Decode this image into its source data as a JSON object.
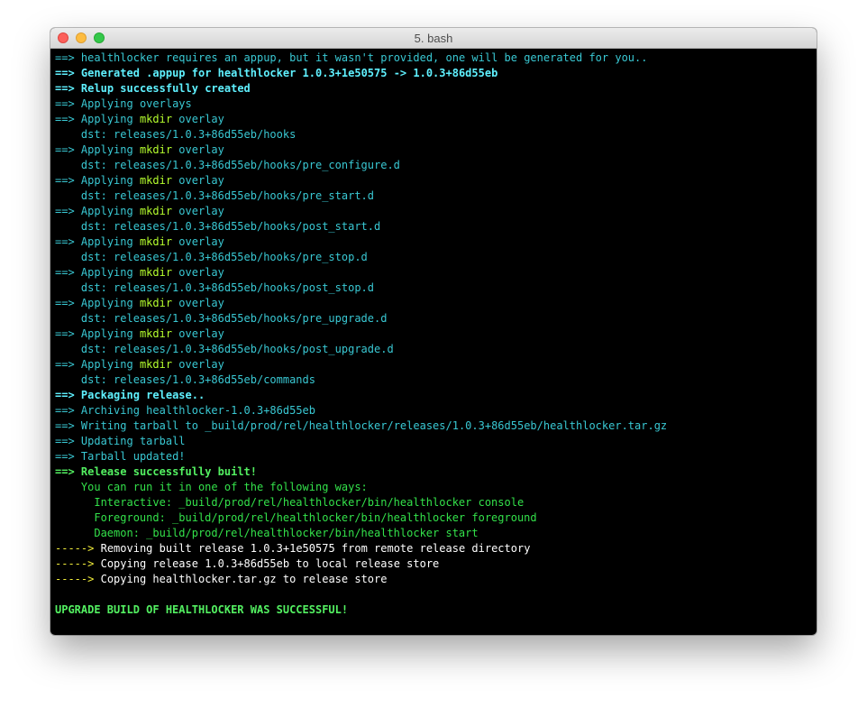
{
  "window": {
    "title": "5. bash"
  },
  "lines": [
    {
      "style": "cyan",
      "prefix": "==>",
      "text": "healthlocker requires an appup, but it wasn't provided, one will be generated for you.."
    },
    {
      "style": "cyanb",
      "prefix": "==>",
      "text": "Generated .appup for healthlocker 1.0.3+1e50575 -> 1.0.3+86d55eb"
    },
    {
      "style": "cyanb",
      "prefix": "==>",
      "text": "Relup successfully created"
    },
    {
      "style": "cyan",
      "prefix": "==>",
      "text": "Applying overlays"
    },
    {
      "style": "cyan",
      "prefix": "==>",
      "pre": "Applying ",
      "kw": "mkdir",
      "post": " overlay"
    },
    {
      "style": "cyan",
      "prefix": "",
      "text": "    dst: releases/1.0.3+86d55eb/hooks"
    },
    {
      "style": "cyan",
      "prefix": "==>",
      "pre": "Applying ",
      "kw": "mkdir",
      "post": " overlay"
    },
    {
      "style": "cyan",
      "prefix": "",
      "text": "    dst: releases/1.0.3+86d55eb/hooks/pre_configure.d"
    },
    {
      "style": "cyan",
      "prefix": "==>",
      "pre": "Applying ",
      "kw": "mkdir",
      "post": " overlay"
    },
    {
      "style": "cyan",
      "prefix": "",
      "text": "    dst: releases/1.0.3+86d55eb/hooks/pre_start.d"
    },
    {
      "style": "cyan",
      "prefix": "==>",
      "pre": "Applying ",
      "kw": "mkdir",
      "post": " overlay"
    },
    {
      "style": "cyan",
      "prefix": "",
      "text": "    dst: releases/1.0.3+86d55eb/hooks/post_start.d"
    },
    {
      "style": "cyan",
      "prefix": "==>",
      "pre": "Applying ",
      "kw": "mkdir",
      "post": " overlay"
    },
    {
      "style": "cyan",
      "prefix": "",
      "text": "    dst: releases/1.0.3+86d55eb/hooks/pre_stop.d"
    },
    {
      "style": "cyan",
      "prefix": "==>",
      "pre": "Applying ",
      "kw": "mkdir",
      "post": " overlay"
    },
    {
      "style": "cyan",
      "prefix": "",
      "text": "    dst: releases/1.0.3+86d55eb/hooks/post_stop.d"
    },
    {
      "style": "cyan",
      "prefix": "==>",
      "pre": "Applying ",
      "kw": "mkdir",
      "post": " overlay"
    },
    {
      "style": "cyan",
      "prefix": "",
      "text": "    dst: releases/1.0.3+86d55eb/hooks/pre_upgrade.d"
    },
    {
      "style": "cyan",
      "prefix": "==>",
      "pre": "Applying ",
      "kw": "mkdir",
      "post": " overlay"
    },
    {
      "style": "cyan",
      "prefix": "",
      "text": "    dst: releases/1.0.3+86d55eb/hooks/post_upgrade.d"
    },
    {
      "style": "cyan",
      "prefix": "==>",
      "pre": "Applying ",
      "kw": "mkdir",
      "post": " overlay"
    },
    {
      "style": "cyan",
      "prefix": "",
      "text": "    dst: releases/1.0.3+86d55eb/commands"
    },
    {
      "style": "cyanb",
      "prefix": "==>",
      "text": "Packaging release.."
    },
    {
      "style": "cyan",
      "prefix": "==>",
      "text": "Archiving healthlocker-1.0.3+86d55eb"
    },
    {
      "style": "cyan",
      "prefix": "==>",
      "text": "Writing tarball to _build/prod/rel/healthlocker/releases/1.0.3+86d55eb/healthlocker.tar.gz"
    },
    {
      "style": "cyan",
      "prefix": "==>",
      "text": "Updating tarball"
    },
    {
      "style": "cyan",
      "prefix": "==>",
      "text": "Tarball updated!"
    },
    {
      "style": "greenb",
      "prefix": "==>",
      "text": "Release successfully built!"
    },
    {
      "style": "green",
      "prefix": "",
      "text": "    You can run it in one of the following ways:"
    },
    {
      "style": "green",
      "prefix": "",
      "text": "      Interactive: _build/prod/rel/healthlocker/bin/healthlocker console"
    },
    {
      "style": "green",
      "prefix": "",
      "text": "      Foreground: _build/prod/rel/healthlocker/bin/healthlocker foreground"
    },
    {
      "style": "green",
      "prefix": "",
      "text": "      Daemon: _build/prod/rel/healthlocker/bin/healthlocker start"
    },
    {
      "style": "white",
      "prefix": "----->",
      "text": "Removing built release 1.0.3+1e50575 from remote release directory"
    },
    {
      "style": "white",
      "prefix": "----->",
      "text": "Copying release 1.0.3+86d55eb to local release store"
    },
    {
      "style": "white",
      "prefix": "----->",
      "text": "Copying healthlocker.tar.gz to release store"
    },
    {
      "style": "blank",
      "prefix": "",
      "text": ""
    },
    {
      "style": "bright",
      "prefix": "",
      "text": "UPGRADE BUILD OF HEALTHLOCKER WAS SUCCESSFUL!"
    }
  ],
  "colors": {
    "background": "#000000",
    "cyan": "#39c8d3",
    "green": "#33e14a",
    "yellow_arrow": "#f2ee3b",
    "white": "#ffffff"
  }
}
